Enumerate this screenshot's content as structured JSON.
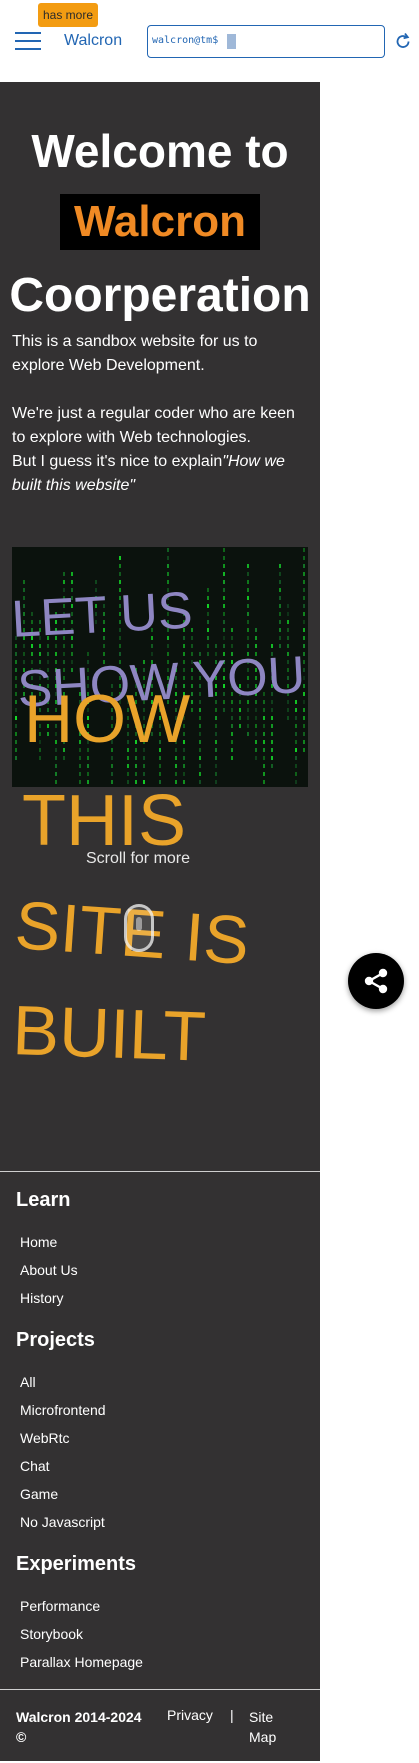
{
  "header": {
    "badge": "has more",
    "brand": "Walcron",
    "terminal_prompt": "walcron@tm$",
    "icons": {
      "menu": "hamburger-icon",
      "refresh": "refresh-icon"
    },
    "accent_color": "#2266b3"
  },
  "hero": {
    "title_line1": "Welcome to",
    "brand_box": "Walcron",
    "title_line3": "Coorperation",
    "intro": {
      "p1": "This is a sandbox website for us to explore Web Development.",
      "p2": "We're just a regular coder who are keen to explore with Web technologies.",
      "p3_prefix": "But I guess it's nice to explain",
      "p3_quote": "\"How we built this website\""
    }
  },
  "animation": {
    "line1": "LET US",
    "line2": "SHOW YOU",
    "line3": "HOW",
    "line4": "THIS",
    "line5": "SITE IS",
    "line6": "BUILT",
    "scroll_hint": "Scroll for more",
    "colors": {
      "purple": "#8e86c2",
      "orange": "#e9a32a"
    }
  },
  "footer": {
    "sections": [
      {
        "title": "Learn",
        "links": [
          "Home",
          "About Us",
          "History"
        ]
      },
      {
        "title": "Projects",
        "links": [
          "All",
          "Microfrontend",
          "WebRtc",
          "Chat",
          "Game",
          "No Javascript"
        ]
      },
      {
        "title": "Experiments",
        "links": [
          "Performance",
          "Storybook",
          "Parallax Homepage"
        ]
      }
    ],
    "copyright": "Walcron 2014-2024",
    "copyright_symbol": "©",
    "privacy": "Privacy",
    "separator": "|",
    "sitemap": "Site Map"
  },
  "share_button": {
    "icon": "share-icon"
  }
}
